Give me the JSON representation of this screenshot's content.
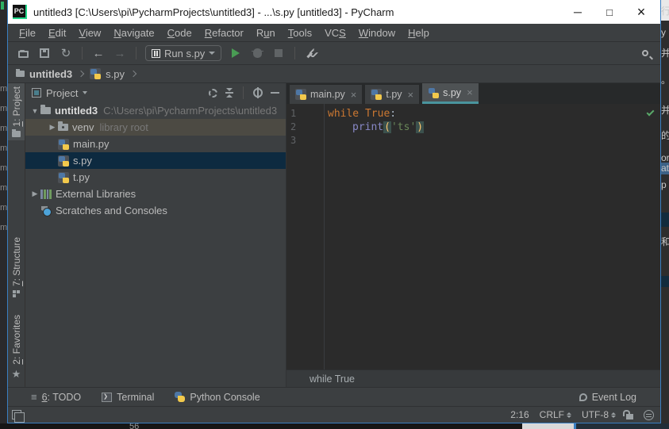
{
  "window": {
    "title": "untitled3 [C:\\Users\\pi\\PycharmProjects\\untitled3] - ...\\s.py [untitled3] - PyCharm",
    "logo": "PC",
    "controls": {
      "minimize": "─",
      "maximize": "□",
      "close": "×"
    }
  },
  "menu": {
    "items": [
      {
        "pre": "",
        "mn": "F",
        "rest": "ile"
      },
      {
        "pre": "",
        "mn": "E",
        "rest": "dit"
      },
      {
        "pre": "",
        "mn": "V",
        "rest": "iew"
      },
      {
        "pre": "",
        "mn": "N",
        "rest": "avigate"
      },
      {
        "pre": "",
        "mn": "C",
        "rest": "ode"
      },
      {
        "pre": "",
        "mn": "R",
        "rest": "efactor"
      },
      {
        "pre": "R",
        "mn": "u",
        "rest": "n"
      },
      {
        "pre": "",
        "mn": "T",
        "rest": "ools"
      },
      {
        "pre": "VC",
        "mn": "S",
        "rest": ""
      },
      {
        "pre": "",
        "mn": "W",
        "rest": "indow"
      },
      {
        "pre": "",
        "mn": "H",
        "rest": "elp"
      }
    ]
  },
  "toolbar": {
    "back": "←",
    "forward": "→",
    "sync": "↻",
    "run_config_label": "Run s.py"
  },
  "breadcrumbs": {
    "project": "untitled3",
    "file": "s.py"
  },
  "stripe": {
    "project": {
      "mn": "1",
      "rest": ": Project"
    },
    "structure": {
      "mn": "7",
      "rest": ": Structure"
    },
    "favorites": {
      "mn": "2",
      "rest": ": Favorites"
    }
  },
  "project_panel": {
    "title": "Project",
    "tree": [
      {
        "arrow": "▼",
        "label": "untitled3",
        "detail": "C:\\Users\\pi\\PycharmProjects\\untitled3"
      },
      {
        "arrow": "▶",
        "label": "venv",
        "detail": "library root"
      },
      {
        "label": "main.py"
      },
      {
        "label": "s.py"
      },
      {
        "label": "t.py"
      },
      {
        "arrow": "▶",
        "label": "External Libraries"
      },
      {
        "label": "Scratches and Consoles"
      }
    ]
  },
  "editor": {
    "tabs": [
      {
        "label": "main.py",
        "close": "×"
      },
      {
        "label": "t.py",
        "close": "×"
      },
      {
        "label": "s.py",
        "close": "×"
      }
    ],
    "gutter": [
      "1",
      "2",
      "3"
    ],
    "code": {
      "line1": {
        "kw1": "while ",
        "kw2": "True",
        "colon": ":"
      },
      "line2": {
        "builtin": "print",
        "open": "(",
        "string": "'ts'",
        "close": ")"
      }
    },
    "breadcrumb": "while True"
  },
  "bottom_bar": {
    "todo": {
      "mn": "6",
      "rest": ": TODO"
    },
    "terminal": "Terminal",
    "python_console": "Python Console",
    "event_log": "Event Log"
  },
  "status_bar": {
    "caret": "2:16",
    "line_ending": "CRLF",
    "encoding": "UTF-8"
  },
  "background": {
    "left_char": "m",
    "bottom_text": "56",
    "right_glyphs": [
      "行",
      "y",
      "并",
      "。",
      "并",
      "的",
      "or",
      "at",
      "p",
      "和"
    ]
  },
  "colors": {
    "accent_teal": "#4A959E",
    "selection_navy": "#0d2a40",
    "keyword_orange": "#cc7832",
    "string_green": "#6a8759",
    "builtin_purple": "#8888c6",
    "paren_yellow": "#ffc66d",
    "run_green": "#499C54",
    "check_green": "#59a869",
    "window_border_blue": "#3a7fc2",
    "titlebar_white": "#ffffff",
    "panel_gray": "#3c3f41",
    "editor_dark": "#2b2b2b"
  }
}
